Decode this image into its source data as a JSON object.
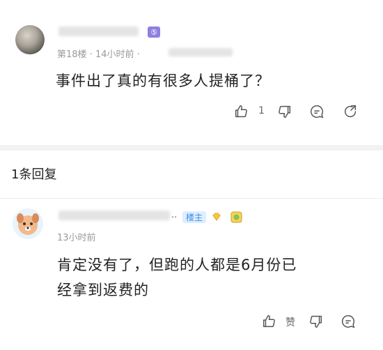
{
  "comment": {
    "floor": "第18楼",
    "time": "14小时前",
    "text": "事件出了真的有很多人提桶了？",
    "like_count": "1",
    "level_badge": "⑤"
  },
  "replies_header": "1条回复",
  "reply": {
    "username_suffix": "..",
    "owner_badge": "楼主",
    "time": "13小时前",
    "text_line1": "肯定没有了，但跑的人都是6月份已",
    "text_line2": "经拿到返费的",
    "like_label": "赞"
  },
  "icons": {
    "like": "thumbs-up-icon",
    "dislike": "thumbs-down-icon",
    "reply": "chat-bubble-icon",
    "share": "share-icon",
    "diamond": "diamond-icon",
    "medal": "medal-icon"
  }
}
